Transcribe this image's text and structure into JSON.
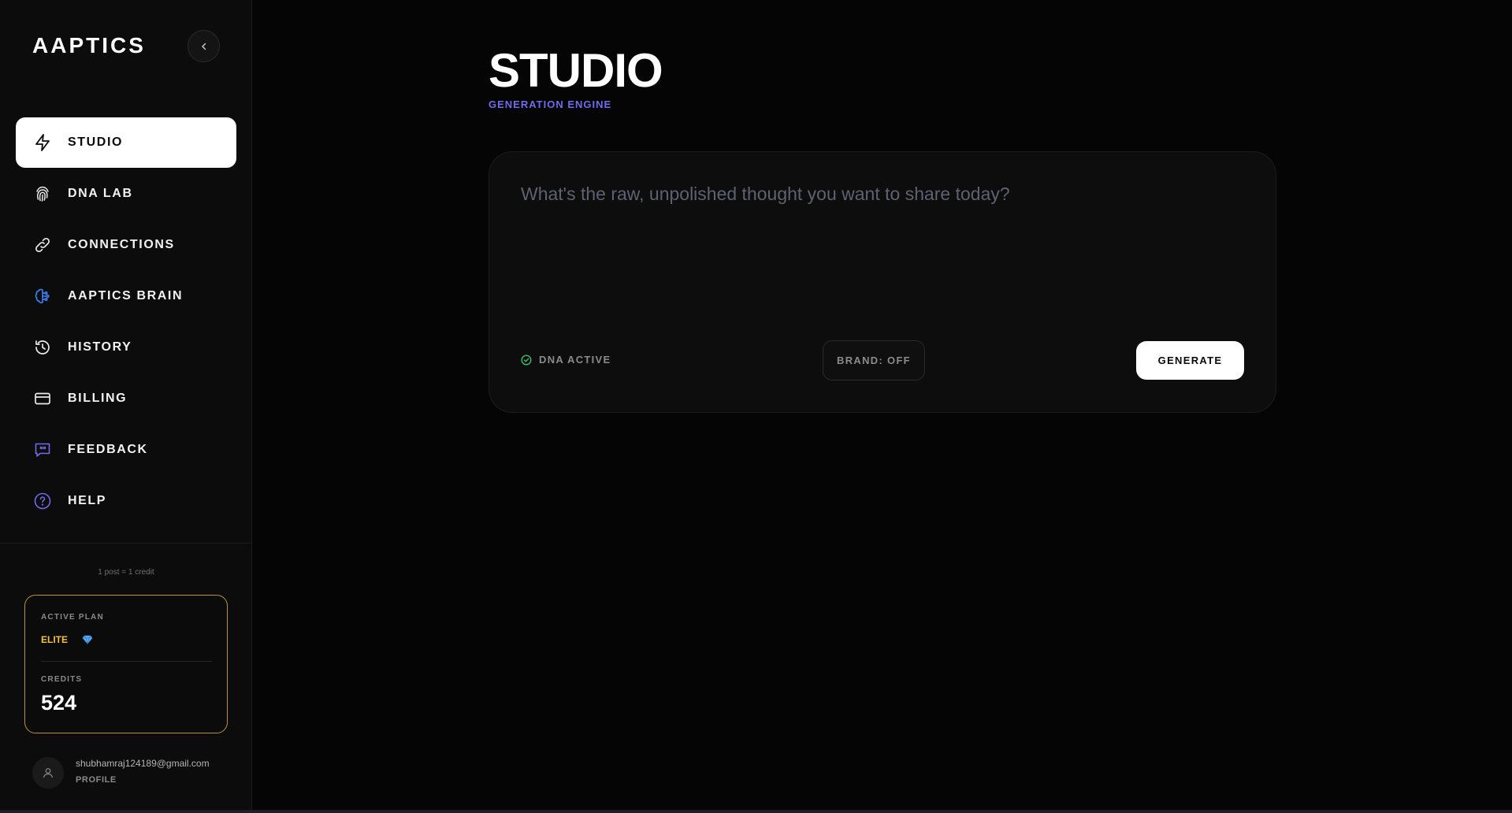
{
  "sidebar": {
    "brand": "AAPTICS",
    "items": [
      {
        "label": "STUDIO",
        "icon": "lightning-icon",
        "active": true
      },
      {
        "label": "DNA LAB",
        "icon": "fingerprint-icon"
      },
      {
        "label": "CONNECTIONS",
        "icon": "link-icon"
      },
      {
        "label": "AAPTICS BRAIN",
        "icon": "brain-icon"
      },
      {
        "label": "HISTORY",
        "icon": "history-icon"
      },
      {
        "label": "BILLING",
        "icon": "credit-card-icon"
      },
      {
        "label": "FEEDBACK",
        "icon": "feedback-icon"
      },
      {
        "label": "HELP",
        "icon": "help-icon"
      }
    ],
    "credit_note": "1 post = 1 credit",
    "plan": {
      "label": "ACTIVE PLAN",
      "name": "ELITE",
      "credits_label": "CREDITS",
      "credits": "524"
    },
    "profile": {
      "email": "shubhamraj124189@gmail.com",
      "link": "PROFILE"
    }
  },
  "main": {
    "title": "STUDIO",
    "subtitle": "GENERATION ENGINE",
    "composer": {
      "placeholder": "What's the raw, unpolished thought you want to share today?",
      "value": "",
      "dna_status": "DNA ACTIVE",
      "brand_toggle": "BRAND: OFF",
      "generate_label": "GENERATE"
    }
  },
  "colors": {
    "background": "#050505",
    "sidebar": "#0c0c0c",
    "accent": "#6f6bea",
    "plan_gold": "#f3c13a",
    "success": "#3fbf6a",
    "brain_blue": "#3b82f6"
  }
}
